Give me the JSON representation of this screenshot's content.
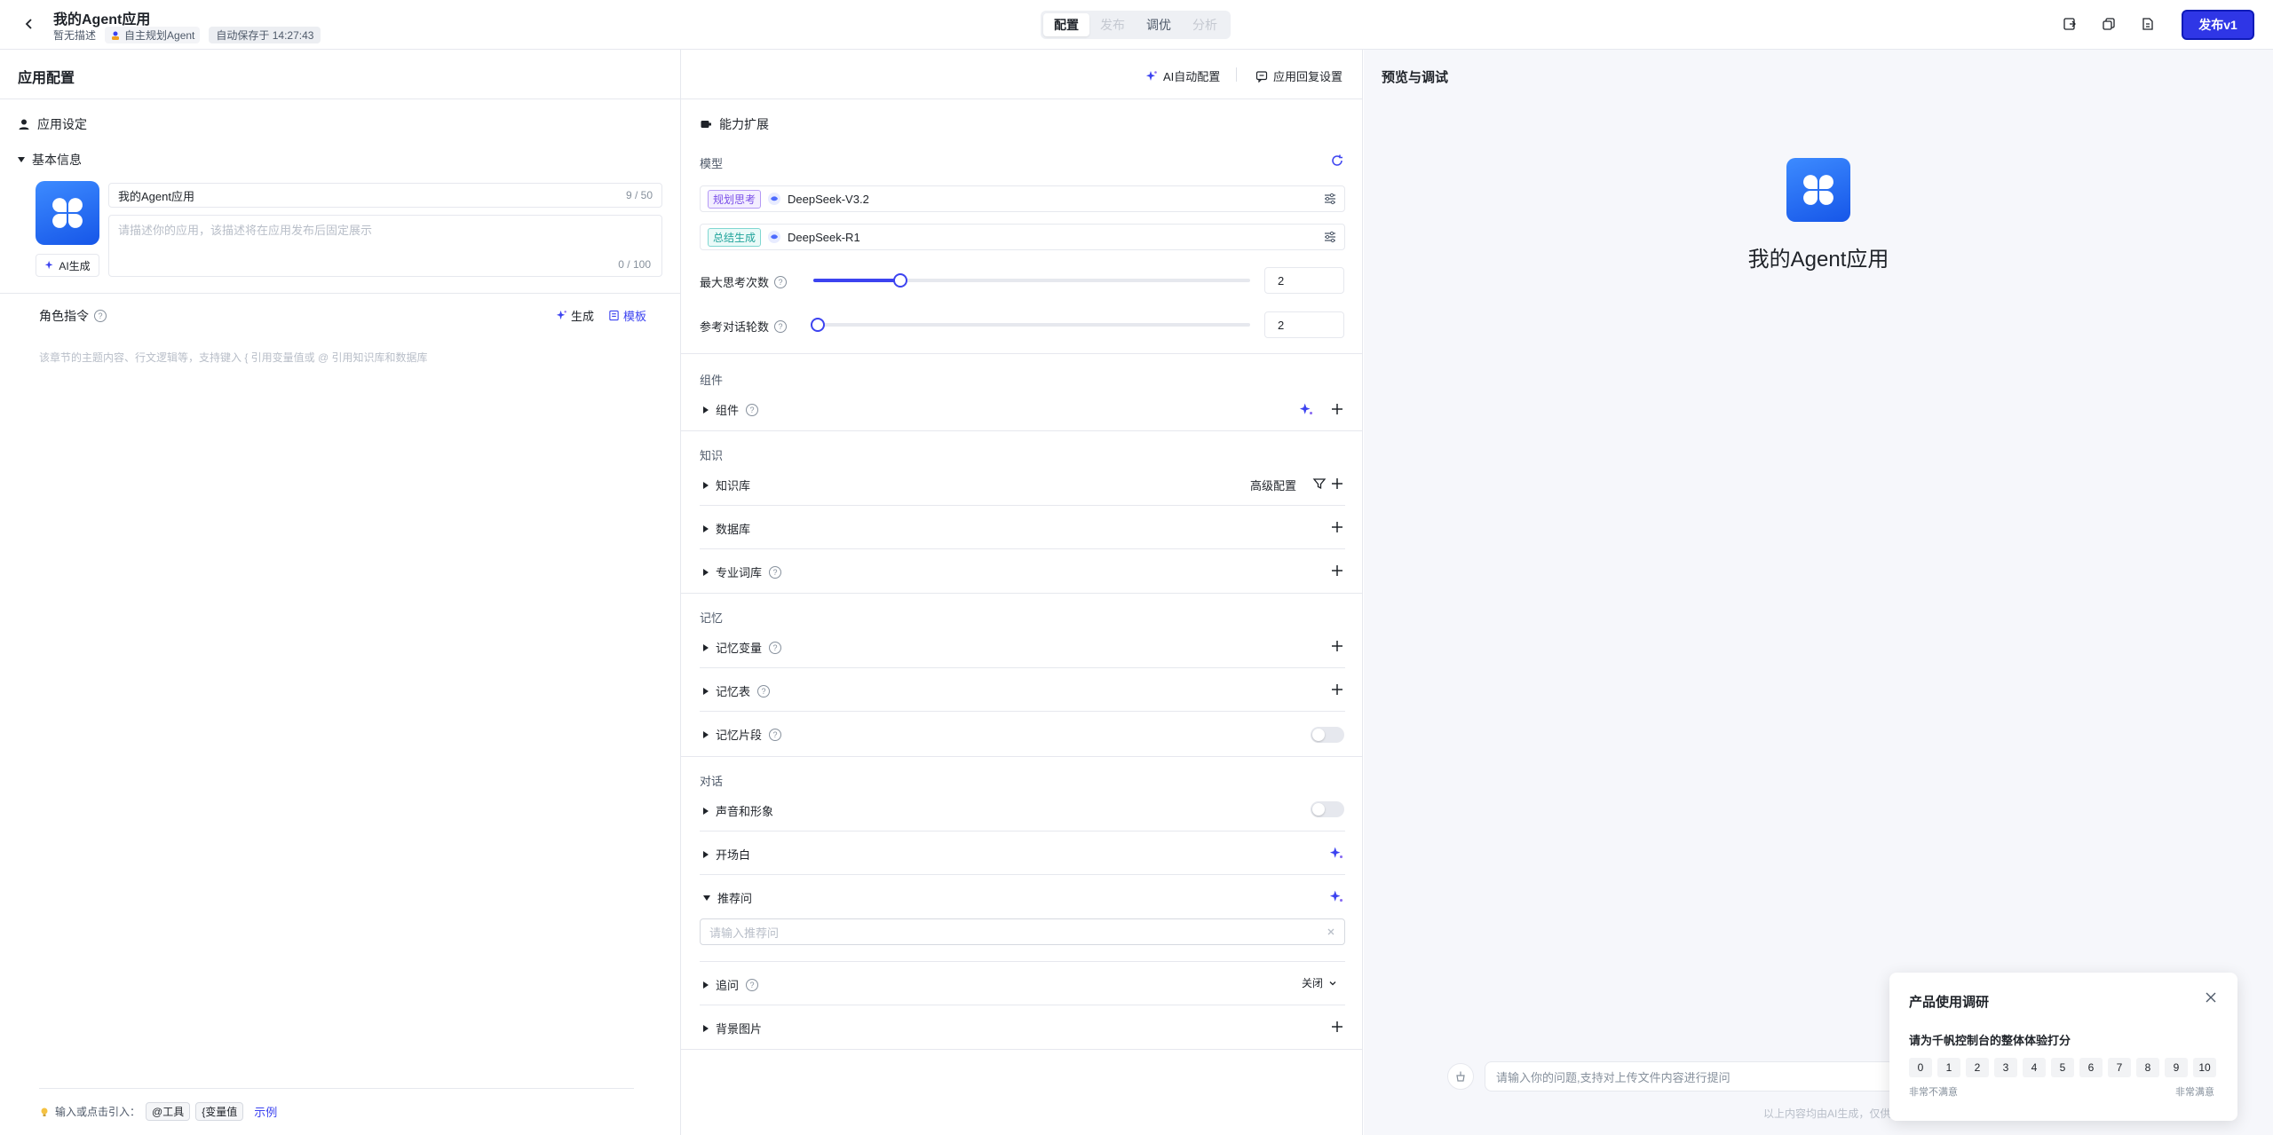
{
  "header": {
    "app_title": "我的Agent应用",
    "no_desc": "暂无描述",
    "agent_type": "自主规划Agent",
    "autosave": "自动保存于 14:27:43",
    "tabs": [
      {
        "label": "配置",
        "state": "active"
      },
      {
        "label": "发布",
        "state": "disabled"
      },
      {
        "label": "调优",
        "state": "normal"
      },
      {
        "label": "分析",
        "state": "disabled"
      }
    ],
    "publish_label": "发布v1"
  },
  "config_bar": {
    "title": "应用配置",
    "ai_auto_config": "AI自动配置",
    "reply_settings": "应用回复设置"
  },
  "app_settings": {
    "section_title": "应用设定",
    "basic_info_title": "基本信息",
    "name_value": "我的Agent应用",
    "name_count": "9 / 50",
    "desc_placeholder": "请描述你的应用，该描述将在应用发布后固定展示",
    "desc_count": "0 / 100",
    "ai_generate": "AI生成",
    "role_title": "角色指令",
    "role_generate": "生成",
    "role_template": "模板",
    "role_placeholder": "该章节的主题内容、行文逻辑等，支持键入 { 引用变量值或 @ 引用知识库和数据库",
    "insert_hint": "输入或点击引入：",
    "chip_tool": "@工具",
    "chip_var": "{变量值",
    "example": "示例"
  },
  "capabilities": {
    "title": "能力扩展",
    "model_label": "模型",
    "models": [
      {
        "tag": "规划思考",
        "name": "DeepSeek-V3.2"
      },
      {
        "tag": "总结生成",
        "name": "DeepSeek-R1"
      }
    ],
    "max_think_label": "最大思考次数",
    "max_think_value": "2",
    "max_think_fraction": 0.2,
    "ref_rounds_label": "参考对话轮数",
    "ref_rounds_value": "2",
    "ref_rounds_fraction": 0.01,
    "group_components": "组件",
    "components": "组件",
    "group_knowledge": "知识",
    "knowledge_base": "知识库",
    "advanced_config": "高级配置",
    "database": "数据库",
    "glossary": "专业词库",
    "group_memory": "记忆",
    "memory_vars": "记忆变量",
    "memory_table": "记忆表",
    "memory_snippet": "记忆片段",
    "group_dialog": "对话",
    "voice": "声音和形象",
    "opening": "开场白",
    "recommend": "推荐问",
    "recommend_placeholder": "请输入推荐问",
    "followup": "追问",
    "followup_value": "关闭",
    "background": "背景图片"
  },
  "preview": {
    "title": "预览与调试",
    "app_name": "我的Agent应用",
    "chat_placeholder": "请输入你的问题,支持对上传文件内容进行提问",
    "footnote": "以上内容均由AI生成，仅供"
  },
  "survey": {
    "title": "产品使用调研",
    "question": "请为千帆控制台的整体体验打分",
    "scores": [
      "0",
      "1",
      "2",
      "3",
      "4",
      "5",
      "6",
      "7",
      "8",
      "9",
      "10"
    ],
    "low_label": "非常不满意",
    "high_label": "非常满意"
  },
  "colors": {
    "accent": "#3c43f0",
    "publish": "#2f36e6",
    "avatar": "#2b73f5"
  }
}
